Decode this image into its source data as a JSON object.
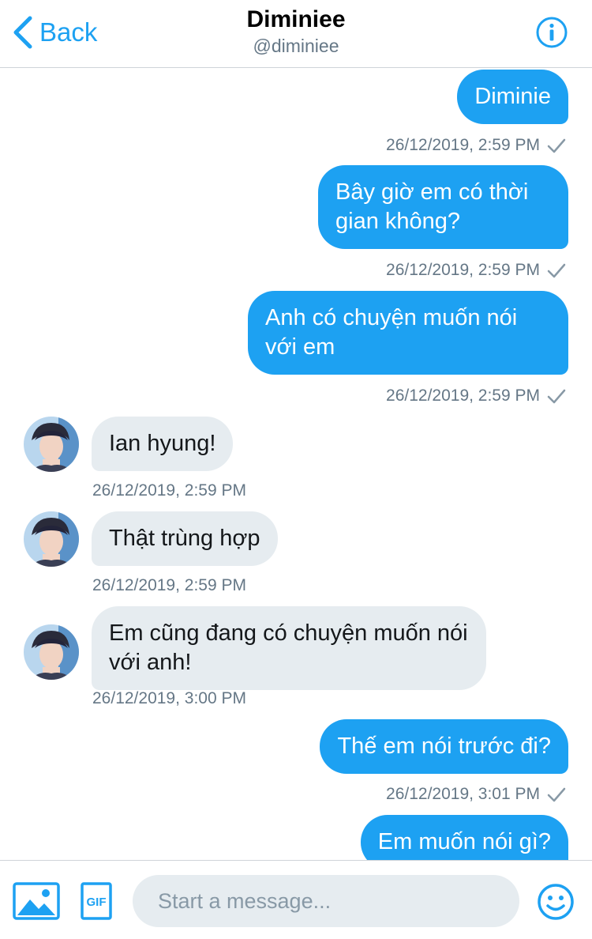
{
  "header": {
    "back_label": "Back",
    "title": "Diminiee",
    "handle": "@diminiee",
    "back_icon": "chevron-left-icon",
    "info_icon": "info-icon"
  },
  "messages": [
    {
      "direction": "outgoing",
      "text": "Diminie",
      "timestamp": "26/12/2019, 2:59 PM",
      "read_icon": "checkmark-icon"
    },
    {
      "direction": "outgoing",
      "text": "Bây giờ em có thời gian không?",
      "timestamp": "26/12/2019, 2:59 PM",
      "read_icon": "checkmark-icon"
    },
    {
      "direction": "outgoing",
      "text": "Anh có chuyện muốn nói với em",
      "timestamp": "26/12/2019, 2:59 PM",
      "read_icon": "checkmark-icon"
    },
    {
      "direction": "incoming",
      "text": "Ian hyung!",
      "timestamp": "26/12/2019, 2:59 PM"
    },
    {
      "direction": "incoming",
      "text": "Thật trùng hợp",
      "timestamp": "26/12/2019, 2:59 PM"
    },
    {
      "direction": "incoming",
      "text": "Em cũng đang có chuyện muốn nói với anh!",
      "timestamp": "26/12/2019, 3:00 PM"
    },
    {
      "direction": "outgoing",
      "text": "Thế em nói trước đi?",
      "timestamp": "26/12/2019, 3:01 PM",
      "read_icon": "checkmark-icon"
    },
    {
      "direction": "outgoing",
      "text": "Em muốn nói gì?"
    }
  ],
  "composer": {
    "placeholder": "Start a message...",
    "photo_icon": "image-icon",
    "gif_icon": "gif-icon",
    "gif_label": "GIF",
    "emoji_icon": "emoji-icon"
  },
  "colors": {
    "accent": "#1da1f2",
    "incoming_bubble": "#e6ecf0",
    "secondary_text": "#657786"
  }
}
